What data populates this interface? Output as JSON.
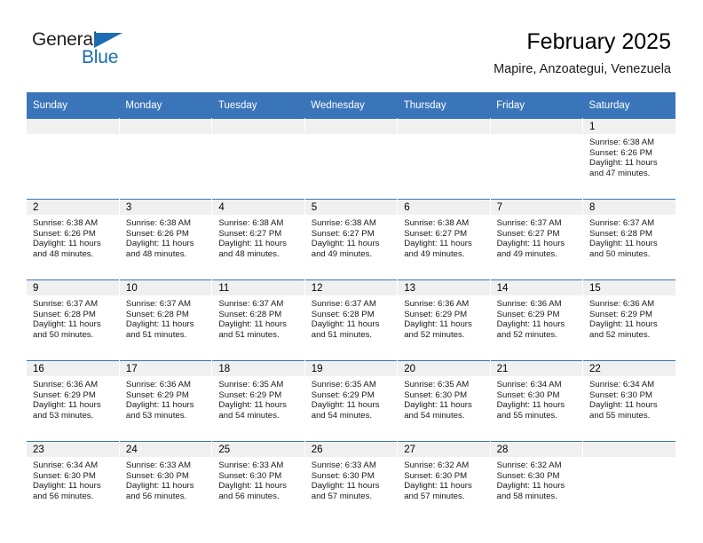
{
  "brand": {
    "name_part1": "General",
    "name_part2": "Blue",
    "triangle_color": "#1b6cb0"
  },
  "header": {
    "title": "February 2025",
    "subtitle": "Mapire, Anzoategui, Venezuela"
  },
  "theme": {
    "header_blue": "#3a75ba",
    "daynum_band": "#f0f0f0",
    "cell_background": "#ffffff",
    "text": "#1a1a1a"
  },
  "weekday_headers": [
    "Sunday",
    "Monday",
    "Tuesday",
    "Wednesday",
    "Thursday",
    "Friday",
    "Saturday"
  ],
  "labels": {
    "sunrise_prefix": "Sunrise:",
    "sunset_prefix": "Sunset:",
    "daylight_prefix": "Daylight:"
  },
  "weeks": [
    [
      {
        "empty": true
      },
      {
        "empty": true
      },
      {
        "empty": true
      },
      {
        "empty": true
      },
      {
        "empty": true
      },
      {
        "empty": true
      },
      {
        "day": "1",
        "sunrise": "Sunrise: 6:38 AM",
        "sunset": "Sunset: 6:26 PM",
        "daylight_line1": "Daylight: 11 hours",
        "daylight_line2": "and 47 minutes."
      }
    ],
    [
      {
        "day": "2",
        "sunrise": "Sunrise: 6:38 AM",
        "sunset": "Sunset: 6:26 PM",
        "daylight_line1": "Daylight: 11 hours",
        "daylight_line2": "and 48 minutes."
      },
      {
        "day": "3",
        "sunrise": "Sunrise: 6:38 AM",
        "sunset": "Sunset: 6:26 PM",
        "daylight_line1": "Daylight: 11 hours",
        "daylight_line2": "and 48 minutes."
      },
      {
        "day": "4",
        "sunrise": "Sunrise: 6:38 AM",
        "sunset": "Sunset: 6:27 PM",
        "daylight_line1": "Daylight: 11 hours",
        "daylight_line2": "and 48 minutes."
      },
      {
        "day": "5",
        "sunrise": "Sunrise: 6:38 AM",
        "sunset": "Sunset: 6:27 PM",
        "daylight_line1": "Daylight: 11 hours",
        "daylight_line2": "and 49 minutes."
      },
      {
        "day": "6",
        "sunrise": "Sunrise: 6:38 AM",
        "sunset": "Sunset: 6:27 PM",
        "daylight_line1": "Daylight: 11 hours",
        "daylight_line2": "and 49 minutes."
      },
      {
        "day": "7",
        "sunrise": "Sunrise: 6:37 AM",
        "sunset": "Sunset: 6:27 PM",
        "daylight_line1": "Daylight: 11 hours",
        "daylight_line2": "and 49 minutes."
      },
      {
        "day": "8",
        "sunrise": "Sunrise: 6:37 AM",
        "sunset": "Sunset: 6:28 PM",
        "daylight_line1": "Daylight: 11 hours",
        "daylight_line2": "and 50 minutes."
      }
    ],
    [
      {
        "day": "9",
        "sunrise": "Sunrise: 6:37 AM",
        "sunset": "Sunset: 6:28 PM",
        "daylight_line1": "Daylight: 11 hours",
        "daylight_line2": "and 50 minutes."
      },
      {
        "day": "10",
        "sunrise": "Sunrise: 6:37 AM",
        "sunset": "Sunset: 6:28 PM",
        "daylight_line1": "Daylight: 11 hours",
        "daylight_line2": "and 51 minutes."
      },
      {
        "day": "11",
        "sunrise": "Sunrise: 6:37 AM",
        "sunset": "Sunset: 6:28 PM",
        "daylight_line1": "Daylight: 11 hours",
        "daylight_line2": "and 51 minutes."
      },
      {
        "day": "12",
        "sunrise": "Sunrise: 6:37 AM",
        "sunset": "Sunset: 6:28 PM",
        "daylight_line1": "Daylight: 11 hours",
        "daylight_line2": "and 51 minutes."
      },
      {
        "day": "13",
        "sunrise": "Sunrise: 6:36 AM",
        "sunset": "Sunset: 6:29 PM",
        "daylight_line1": "Daylight: 11 hours",
        "daylight_line2": "and 52 minutes."
      },
      {
        "day": "14",
        "sunrise": "Sunrise: 6:36 AM",
        "sunset": "Sunset: 6:29 PM",
        "daylight_line1": "Daylight: 11 hours",
        "daylight_line2": "and 52 minutes."
      },
      {
        "day": "15",
        "sunrise": "Sunrise: 6:36 AM",
        "sunset": "Sunset: 6:29 PM",
        "daylight_line1": "Daylight: 11 hours",
        "daylight_line2": "and 52 minutes."
      }
    ],
    [
      {
        "day": "16",
        "sunrise": "Sunrise: 6:36 AM",
        "sunset": "Sunset: 6:29 PM",
        "daylight_line1": "Daylight: 11 hours",
        "daylight_line2": "and 53 minutes."
      },
      {
        "day": "17",
        "sunrise": "Sunrise: 6:36 AM",
        "sunset": "Sunset: 6:29 PM",
        "daylight_line1": "Daylight: 11 hours",
        "daylight_line2": "and 53 minutes."
      },
      {
        "day": "18",
        "sunrise": "Sunrise: 6:35 AM",
        "sunset": "Sunset: 6:29 PM",
        "daylight_line1": "Daylight: 11 hours",
        "daylight_line2": "and 54 minutes."
      },
      {
        "day": "19",
        "sunrise": "Sunrise: 6:35 AM",
        "sunset": "Sunset: 6:29 PM",
        "daylight_line1": "Daylight: 11 hours",
        "daylight_line2": "and 54 minutes."
      },
      {
        "day": "20",
        "sunrise": "Sunrise: 6:35 AM",
        "sunset": "Sunset: 6:30 PM",
        "daylight_line1": "Daylight: 11 hours",
        "daylight_line2": "and 54 minutes."
      },
      {
        "day": "21",
        "sunrise": "Sunrise: 6:34 AM",
        "sunset": "Sunset: 6:30 PM",
        "daylight_line1": "Daylight: 11 hours",
        "daylight_line2": "and 55 minutes."
      },
      {
        "day": "22",
        "sunrise": "Sunrise: 6:34 AM",
        "sunset": "Sunset: 6:30 PM",
        "daylight_line1": "Daylight: 11 hours",
        "daylight_line2": "and 55 minutes."
      }
    ],
    [
      {
        "day": "23",
        "sunrise": "Sunrise: 6:34 AM",
        "sunset": "Sunset: 6:30 PM",
        "daylight_line1": "Daylight: 11 hours",
        "daylight_line2": "and 56 minutes."
      },
      {
        "day": "24",
        "sunrise": "Sunrise: 6:33 AM",
        "sunset": "Sunset: 6:30 PM",
        "daylight_line1": "Daylight: 11 hours",
        "daylight_line2": "and 56 minutes."
      },
      {
        "day": "25",
        "sunrise": "Sunrise: 6:33 AM",
        "sunset": "Sunset: 6:30 PM",
        "daylight_line1": "Daylight: 11 hours",
        "daylight_line2": "and 56 minutes."
      },
      {
        "day": "26",
        "sunrise": "Sunrise: 6:33 AM",
        "sunset": "Sunset: 6:30 PM",
        "daylight_line1": "Daylight: 11 hours",
        "daylight_line2": "and 57 minutes."
      },
      {
        "day": "27",
        "sunrise": "Sunrise: 6:32 AM",
        "sunset": "Sunset: 6:30 PM",
        "daylight_line1": "Daylight: 11 hours",
        "daylight_line2": "and 57 minutes."
      },
      {
        "day": "28",
        "sunrise": "Sunrise: 6:32 AM",
        "sunset": "Sunset: 6:30 PM",
        "daylight_line1": "Daylight: 11 hours",
        "daylight_line2": "and 58 minutes."
      },
      {
        "empty": true
      }
    ]
  ]
}
